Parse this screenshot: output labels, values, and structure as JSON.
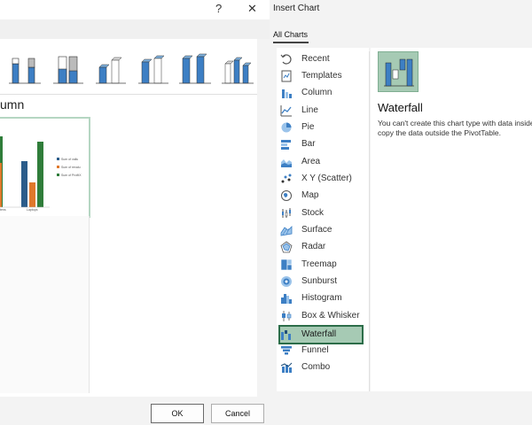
{
  "left_dialog": {
    "help_glyph": "?",
    "close_glyph": "✕",
    "subtype_title": "umn",
    "preview": {
      "legend": [
        "Sum of vallu",
        "Sum of revalu",
        "Sum of ProfitX"
      ],
      "x_labels": [
        "tens",
        "Laptops"
      ]
    },
    "ok_label": "OK",
    "cancel_label": "Cancel"
  },
  "right_dialog": {
    "title": "Insert Chart",
    "tab_all": "All Charts",
    "chart_types": [
      {
        "label": "Recent",
        "icon": "recent-icon"
      },
      {
        "label": "Templates",
        "icon": "templates-icon"
      },
      {
        "label": "Column",
        "icon": "column-chart-icon"
      },
      {
        "label": "Line",
        "icon": "line-chart-icon"
      },
      {
        "label": "Pie",
        "icon": "pie-chart-icon"
      },
      {
        "label": "Bar",
        "icon": "bar-chart-icon"
      },
      {
        "label": "Area",
        "icon": "area-chart-icon"
      },
      {
        "label": "X Y (Scatter)",
        "icon": "scatter-chart-icon"
      },
      {
        "label": "Map",
        "icon": "map-chart-icon"
      },
      {
        "label": "Stock",
        "icon": "stock-chart-icon"
      },
      {
        "label": "Surface",
        "icon": "surface-chart-icon"
      },
      {
        "label": "Radar",
        "icon": "radar-chart-icon"
      },
      {
        "label": "Treemap",
        "icon": "treemap-chart-icon"
      },
      {
        "label": "Sunburst",
        "icon": "sunburst-chart-icon"
      },
      {
        "label": "Histogram",
        "icon": "histogram-chart-icon"
      },
      {
        "label": "Box & Whisker",
        "icon": "box-whisker-chart-icon"
      },
      {
        "label": "Waterfall",
        "icon": "waterfall-chart-icon"
      },
      {
        "label": "Funnel",
        "icon": "funnel-chart-icon"
      },
      {
        "label": "Combo",
        "icon": "combo-chart-icon"
      }
    ],
    "selected": "Waterfall",
    "detail": {
      "heading": "Waterfall",
      "desc_line1": "You can't create this chart type with data inside",
      "desc_line2": "copy the data outside the PivotTable."
    }
  },
  "colors": {
    "selection_fill": "#a6cab4",
    "selection_border": "#2c6d49",
    "icon_blue": "#3d7fc4",
    "bar_green": "#2f7d3a",
    "bar_blue": "#2b5c8a",
    "bar_orange": "#e0782b"
  }
}
